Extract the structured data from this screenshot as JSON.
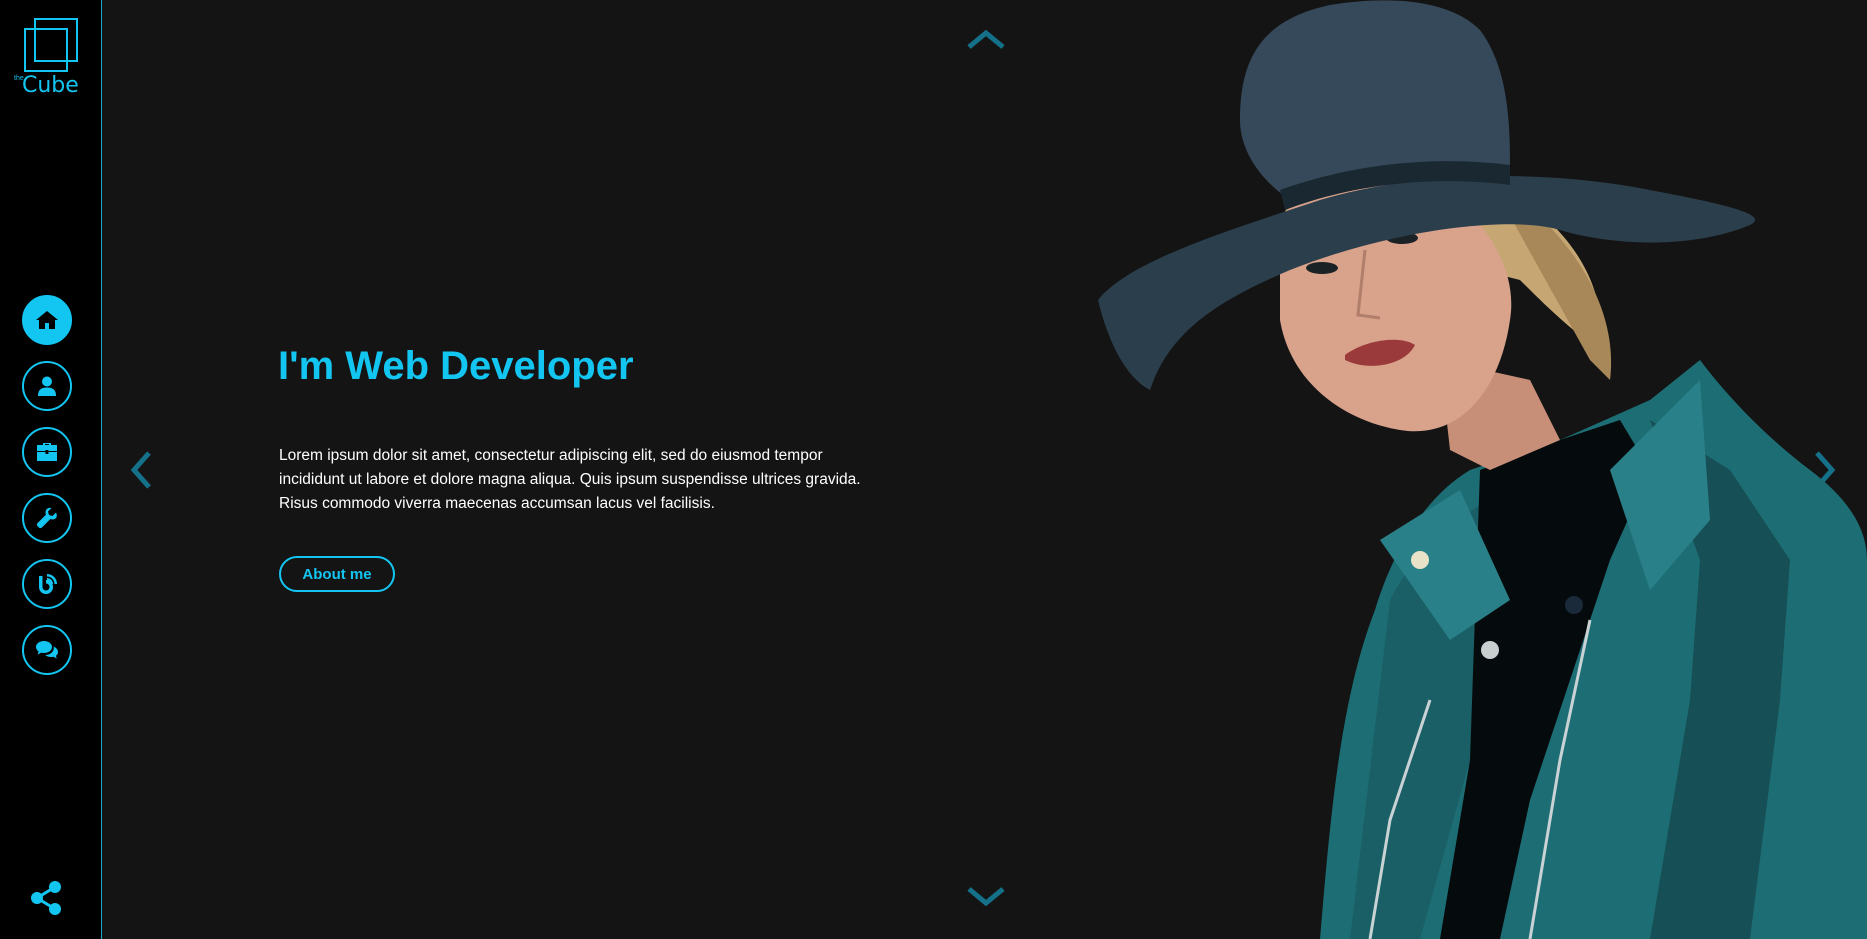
{
  "brand": {
    "logo_small": "the",
    "logo_text": "Cube"
  },
  "sidebar": {
    "items": [
      {
        "icon": "home-icon",
        "active": true
      },
      {
        "icon": "user-icon",
        "active": false
      },
      {
        "icon": "briefcase-icon",
        "active": false
      },
      {
        "icon": "wrench-icon",
        "active": false
      },
      {
        "icon": "blog-icon",
        "active": false
      },
      {
        "icon": "chat-icon",
        "active": false
      }
    ],
    "share_icon": "share-icon"
  },
  "hero": {
    "title": "I'm Web Developer",
    "text": "Lorem ipsum dolor sit amet, consectetur adipiscing elit, sed do eiusmod tempor incididunt ut labore et dolore magna aliqua. Quis ipsum suspendisse ultrices gravida. Risus commodo viverra maecenas accumsan lacus vel facilisis.",
    "button_label": "About me"
  },
  "colors": {
    "accent": "#13c6f2",
    "background": "#141414",
    "sidebar_bg": "#000000",
    "arrow": "#15708a"
  }
}
